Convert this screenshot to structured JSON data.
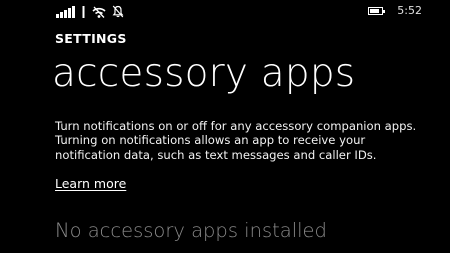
{
  "status_bar": {
    "icons": [
      "signal-strength-icon",
      "data-connection-icon",
      "wifi-icon",
      "quiet-hours-icon",
      "battery-icon"
    ],
    "battery_level": 0.85,
    "time": "5:52"
  },
  "header": {
    "section": "SETTINGS",
    "title": "accessory apps"
  },
  "main": {
    "description": "Turn notifications on or off for any accessory companion apps. Turning on notifications allows an app to receive your notification data, such as text messages and caller IDs.",
    "learn_more_link": "Learn more",
    "empty_message": "No accessory apps installed"
  }
}
